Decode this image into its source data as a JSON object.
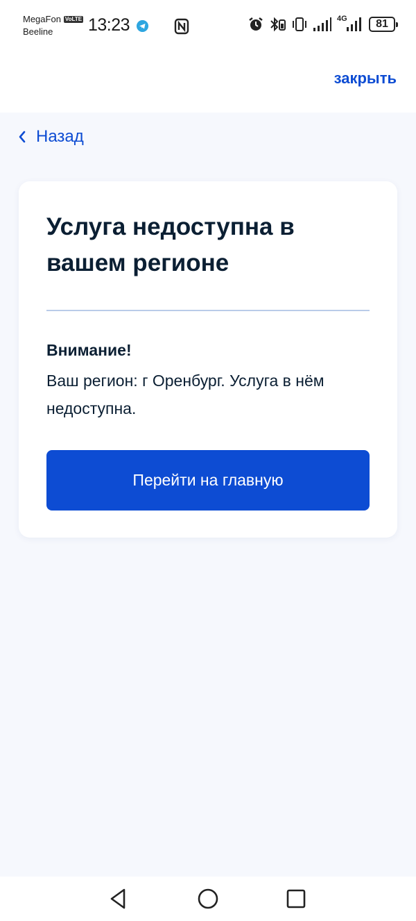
{
  "status_bar": {
    "carrier_primary": "MegaFon",
    "volte_badge": "VoLTE",
    "carrier_secondary": "Beeline",
    "time": "13:23",
    "network": "4G",
    "battery": "81"
  },
  "header": {
    "close_label": "закрыть"
  },
  "nav": {
    "back_label": "Назад"
  },
  "card": {
    "title": "Услуга недоступна в вашем регионе",
    "attention": "Внимание!",
    "message": "Ваш регион: г Оренбург. Услуга в нём недоступна.",
    "button_label": "Перейти на главную"
  },
  "colors": {
    "accent": "#0d4cd3",
    "background": "#f6f8fd",
    "text": "#0b1f33"
  },
  "icons": {
    "status": [
      "telegram-icon",
      "nfc-icon",
      "alarm-icon",
      "bluetooth-icon",
      "vibrate-icon",
      "signal-icon",
      "battery-icon"
    ],
    "navigation": [
      "back-chevron-icon",
      "nav-back-icon",
      "nav-home-icon",
      "nav-recents-icon"
    ]
  }
}
